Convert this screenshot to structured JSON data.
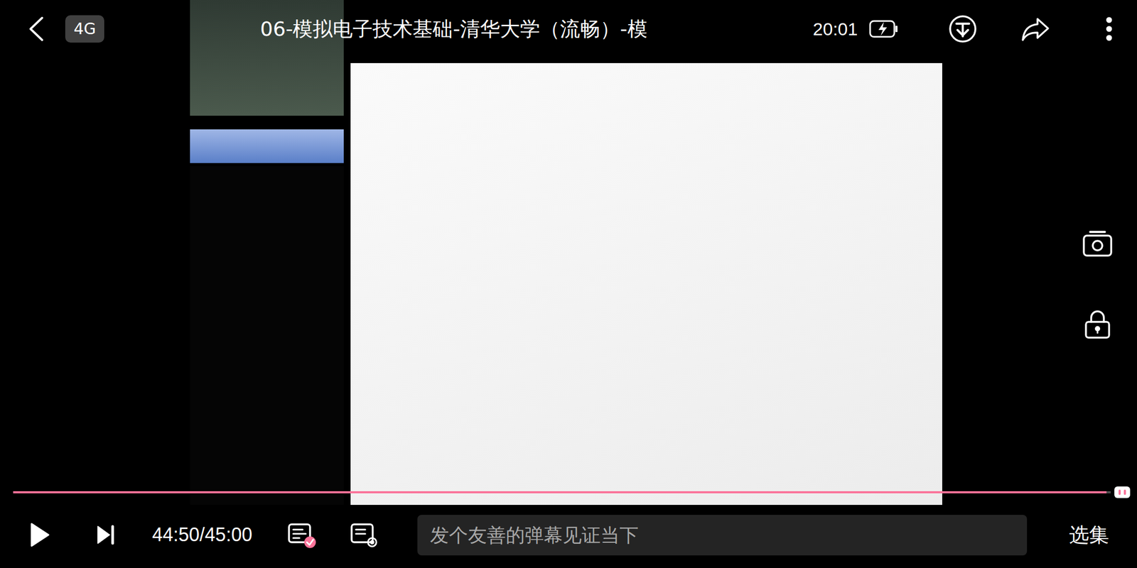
{
  "status": {
    "network": "4G",
    "time": "20:01",
    "battery_charging": true
  },
  "video": {
    "title": "06-模拟电子技术基础-清华大学（流畅）-模"
  },
  "player": {
    "playing": false
  },
  "progress": {
    "level": 0.996,
    "time": "44:50/45:00"
  },
  "danmaku": {
    "enabled": true,
    "placeholder": "发个友善的弹幕见证当下"
  },
  "buttons": {
    "episodes": "选集"
  }
}
